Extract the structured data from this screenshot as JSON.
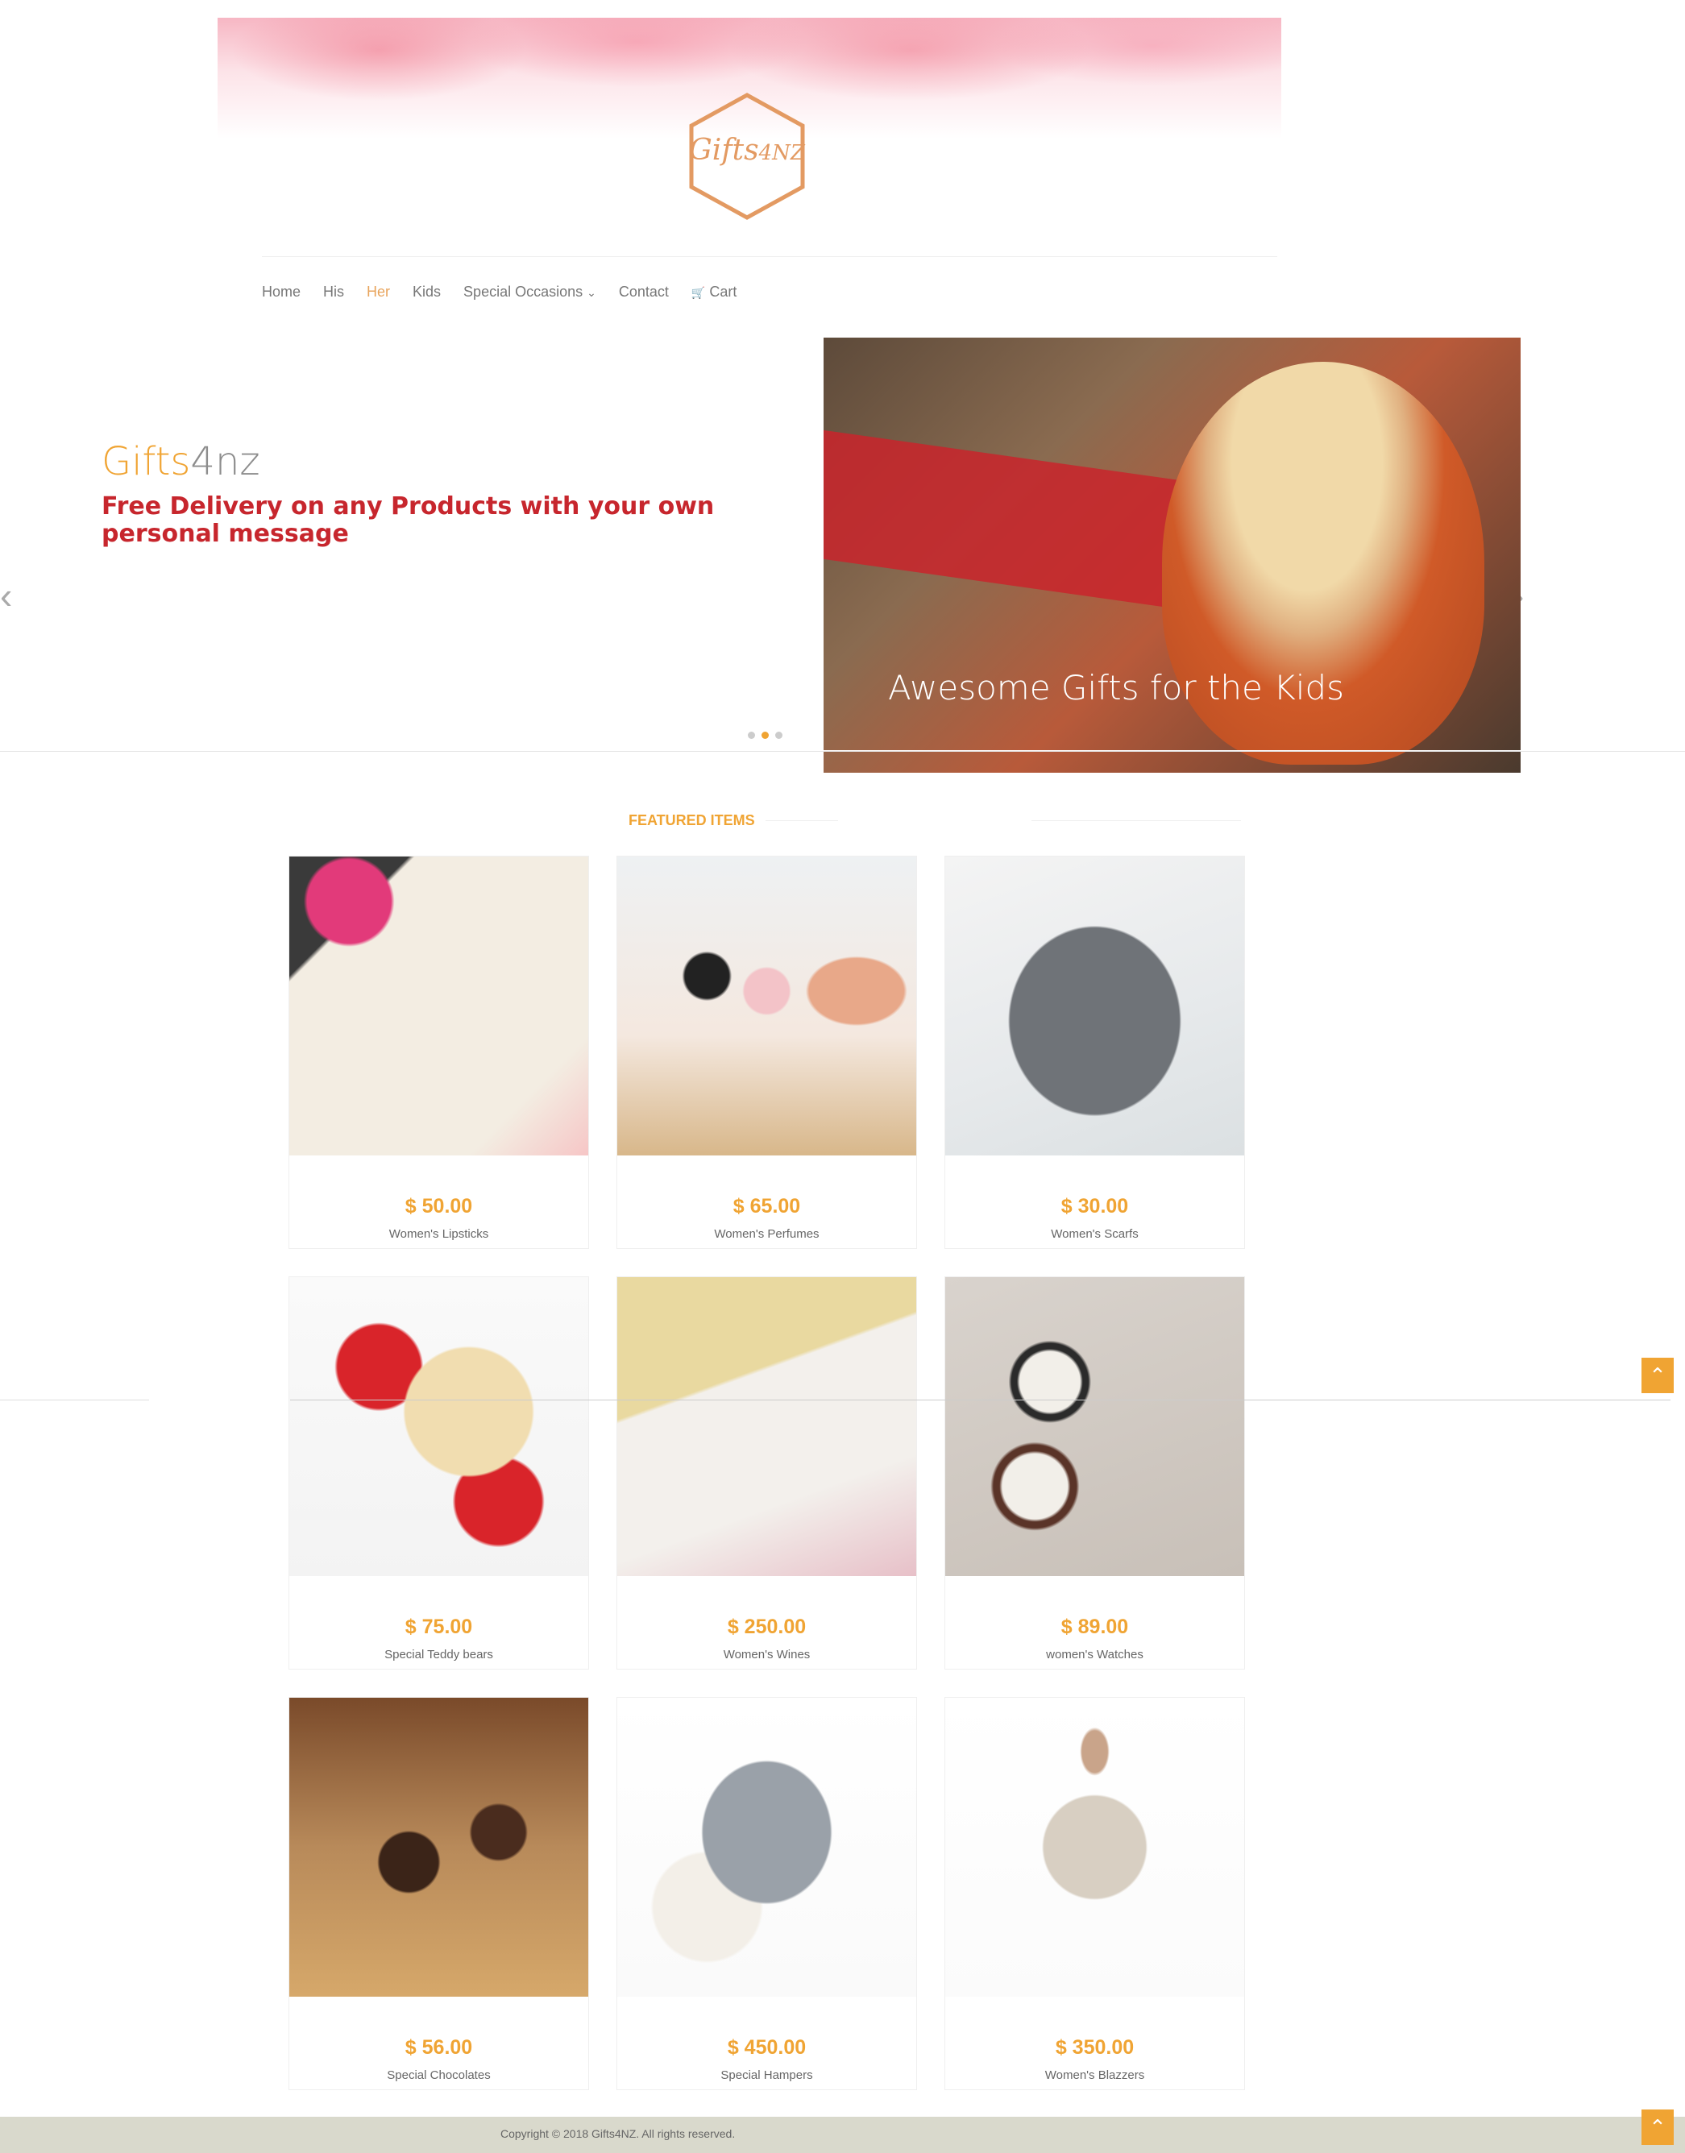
{
  "logo": {
    "main": "Gifts",
    "sub": "4NZ"
  },
  "nav": [
    {
      "label": "Home",
      "active": false
    },
    {
      "label": "His",
      "active": false
    },
    {
      "label": "Her",
      "active": true
    },
    {
      "label": "Kids",
      "active": false
    },
    {
      "label": "Special Occasions",
      "icon": "chevron-down-icon",
      "active": false
    },
    {
      "label": "Contact",
      "active": false
    },
    {
      "label": "Cart",
      "icon": "cart-icon",
      "active": false
    }
  ],
  "slider": {
    "brand_part1": "Gifts",
    "brand_part2": "4nz",
    "tagline": "Free Delivery on any Products with your own personal message",
    "caption": "Awesome Gifts for the Kids",
    "dots": [
      false,
      true,
      false
    ],
    "prev_arrow": "‹",
    "next_arrow": "›"
  },
  "featured": {
    "title": "FEATURED ITEMS",
    "items": [
      {
        "price": "$ 50.00",
        "name": "Women's Lipsticks"
      },
      {
        "price": "$ 65.00",
        "name": "Women's Perfumes"
      },
      {
        "price": "$ 30.00",
        "name": "Women's Scarfs"
      },
      {
        "price": "$ 75.00",
        "name": "Special Teddy bears"
      },
      {
        "price": "$ 250.00",
        "name": "Women's Wines"
      },
      {
        "price": "$ 89.00",
        "name": "women's Watches"
      },
      {
        "price": "$ 56.00",
        "name": "Special Chocolates"
      },
      {
        "price": "$ 450.00",
        "name": "Special Hampers"
      },
      {
        "price": "$ 350.00",
        "name": "Women's Blazzers"
      }
    ]
  },
  "footer": {
    "copyright": "Copyright © 2018 Gifts4NZ. All rights reserved."
  },
  "colors": {
    "accent": "#f0a433",
    "tagline": "#c7262d",
    "footer_bg": "#d9d9cc"
  }
}
